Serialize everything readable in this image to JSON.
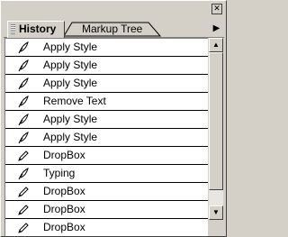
{
  "panel": {
    "close_glyph": "✕",
    "menu_glyph": "▶"
  },
  "tabs": [
    {
      "label": "History",
      "active": true
    },
    {
      "label": "Markup Tree",
      "active": false
    }
  ],
  "history": [
    {
      "icon": "feather-icon",
      "label": "Apply Style"
    },
    {
      "icon": "feather-icon",
      "label": "Apply Style"
    },
    {
      "icon": "feather-icon",
      "label": "Apply Style"
    },
    {
      "icon": "feather-icon",
      "label": "Remove Text"
    },
    {
      "icon": "feather-icon",
      "label": "Apply Style"
    },
    {
      "icon": "feather-icon",
      "label": "Apply Style"
    },
    {
      "icon": "pencil-icon",
      "label": "DropBox"
    },
    {
      "icon": "feather-icon",
      "label": "Typing"
    },
    {
      "icon": "pencil-icon",
      "label": "DropBox"
    },
    {
      "icon": "pencil-icon",
      "label": "DropBox"
    },
    {
      "icon": "pencil-icon",
      "label": "DropBox"
    }
  ],
  "scrollbar": {
    "up_glyph": "▲",
    "down_glyph": "▼",
    "visible_fraction": 0.9
  }
}
